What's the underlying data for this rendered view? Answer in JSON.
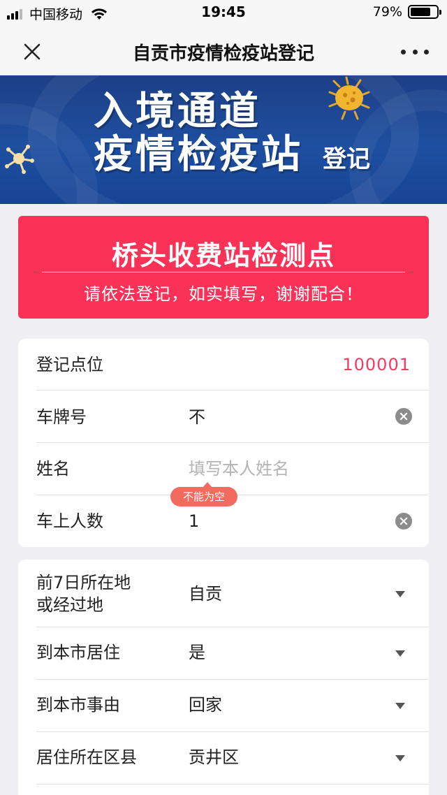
{
  "status_bar": {
    "carrier": "中国移动",
    "time": "19:45",
    "battery": "79%",
    "battery_level": 0.79
  },
  "nav": {
    "title": "自贡市疫情检疫站登记"
  },
  "banner": {
    "line1": "入境通道",
    "line2": "疫情检疫站",
    "suffix": "登记"
  },
  "header_card": {
    "title": "桥头收费站检测点",
    "subtitle": "请依法登记，如实填写，谢谢配合！"
  },
  "form": {
    "registration_point": {
      "label": "登记点位",
      "value": "100001"
    },
    "plate_number": {
      "label": "车牌号",
      "value": "不"
    },
    "name": {
      "label": "姓名",
      "placeholder": "填写本人姓名",
      "error": "不能为空"
    },
    "passenger_count": {
      "label": "车上人数",
      "value": "1"
    },
    "past_7_days_location": {
      "label_line1": "前7日所在地",
      "label_line2": "或经过地",
      "value": "自贡"
    },
    "residing_in_city": {
      "label": "到本市居住",
      "value": "是"
    },
    "reason": {
      "label": "到本市事由",
      "value": "回家"
    },
    "district": {
      "label": "居住所在区县",
      "value": "贡井区"
    }
  },
  "colors": {
    "accent_red": "#fb3257",
    "error_tip": "#f26b5f",
    "banner_blue": "#1e4fa0"
  }
}
